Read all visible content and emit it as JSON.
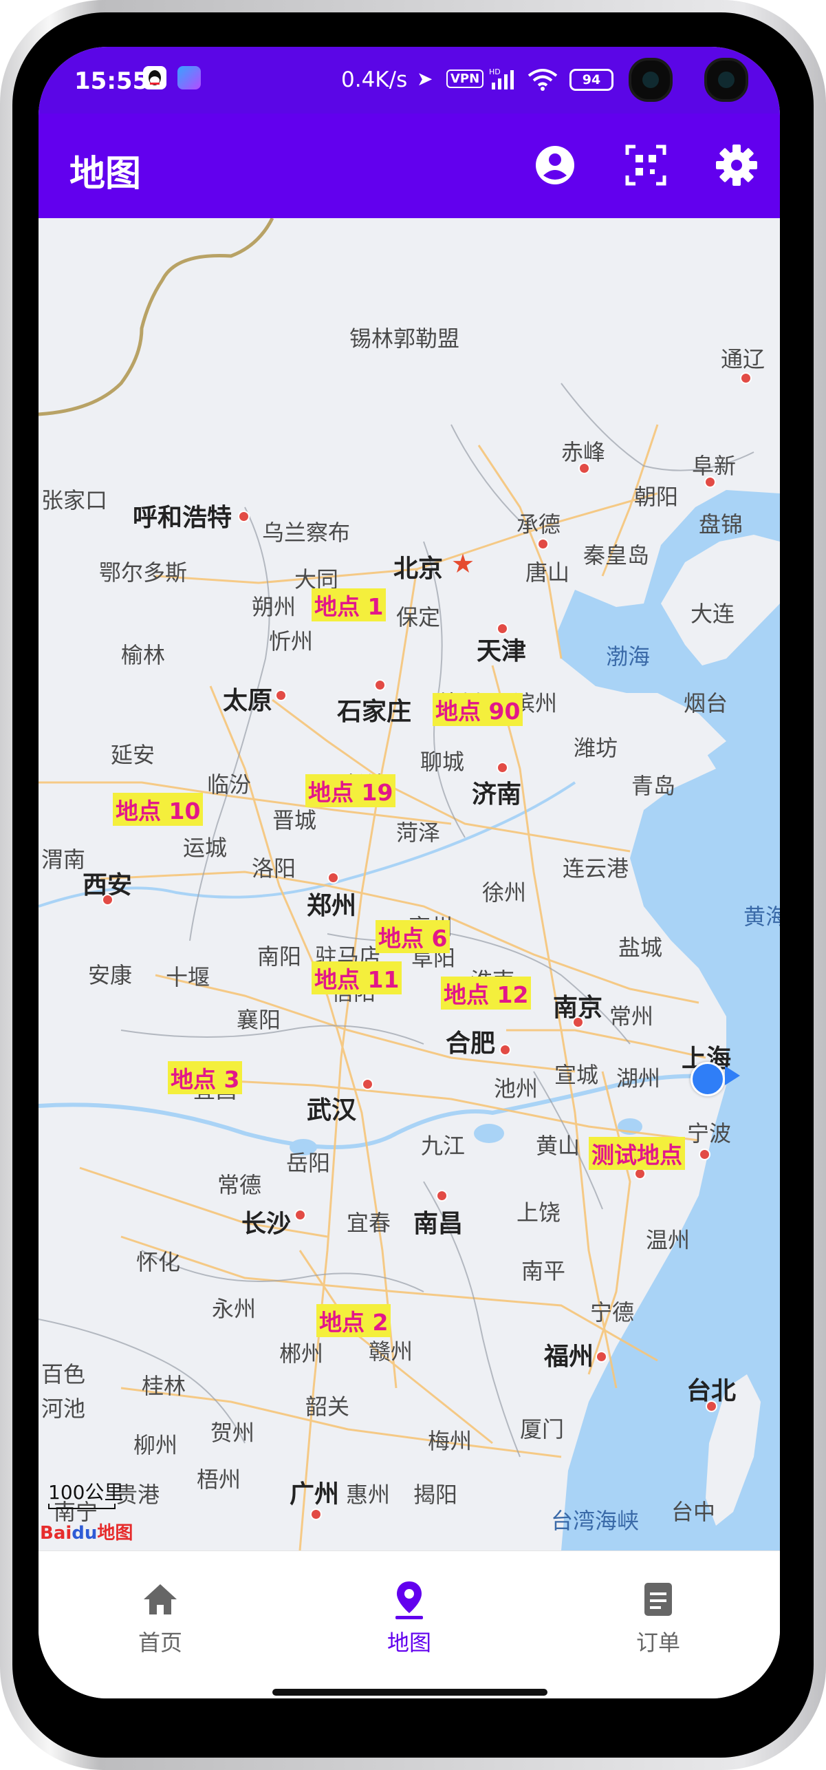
{
  "status_bar": {
    "time": "15:55",
    "net_speed": "0.4K/s",
    "vpn": "VPN",
    "battery": "94"
  },
  "app_bar": {
    "title": "地图",
    "icons": [
      "account-circle-icon",
      "qr-scan-icon",
      "settings-gear-icon"
    ]
  },
  "map": {
    "provider_logo": "Baidu地图",
    "scale_label": "100公里",
    "region_labels": [
      "锡林郭勒盟"
    ],
    "sea_labels": [
      "渤海",
      "黄海",
      "台湾海峡"
    ],
    "major_cities": [
      "北京",
      "天津",
      "石家庄",
      "太原",
      "济南",
      "郑州",
      "西安",
      "南京",
      "合肥",
      "武汉",
      "长沙",
      "南昌",
      "福州",
      "广州",
      "上海",
      "台北",
      "呼和浩特"
    ],
    "cities": [
      "通辽",
      "赤峰",
      "阜新",
      "朝阳",
      "盘锦",
      "承德",
      "乌兰察布",
      "大同",
      "唐山",
      "秦皇岛",
      "大连",
      "朔州",
      "保定",
      "忻州",
      "榆林",
      "鄂尔多斯",
      "德州",
      "滨州",
      "烟台",
      "潍坊",
      "聊城",
      "青岛",
      "延安",
      "临汾",
      "晋城",
      "长治",
      "菏泽",
      "运城",
      "洛阳",
      "连云港",
      "徐州",
      "亳州",
      "盐城",
      "安康",
      "十堰",
      "南阳",
      "驻马店",
      "阜阳",
      "淮南",
      "信阳",
      "襄阳",
      "常州",
      "宣城",
      "湖州",
      "池州",
      "宜昌",
      "九江",
      "黄山",
      "宁波",
      "岳阳",
      "常德",
      "上饶",
      "宜春",
      "怀化",
      "温州",
      "南平",
      "永州",
      "宁德",
      "郴州",
      "赣州",
      "桂林",
      "韶关",
      "贺州",
      "梅州",
      "厦门",
      "台中",
      "柳州",
      "梧州",
      "贵港",
      "惠州",
      "揭阳",
      "南宁",
      "河池",
      "百色",
      "渭南",
      "张家口"
    ],
    "markers": [
      "地点 1",
      "地点 90",
      "地点 19",
      "地点 10",
      "地点 6",
      "地点 11",
      "地点 12",
      "地点 3",
      "测试地点",
      "地点 2"
    ]
  },
  "bottom_nav": {
    "items": [
      {
        "label": "首页",
        "icon": "home-icon"
      },
      {
        "label": "地图",
        "icon": "map-pin-icon",
        "active": true
      },
      {
        "label": "订单",
        "icon": "document-icon"
      }
    ]
  }
}
